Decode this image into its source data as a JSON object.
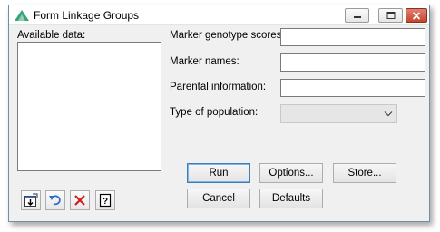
{
  "window": {
    "title": "Form Linkage Groups"
  },
  "titlebar_buttons": {
    "minimize_icon": "minimize-icon",
    "maximize_icon": "maximize-icon",
    "close_icon": "close-icon"
  },
  "available_data": {
    "label": "Available data:",
    "items": []
  },
  "fields": {
    "marker_genotype_scores": {
      "label": "Marker genotype scores:",
      "value": ""
    },
    "marker_names": {
      "label": "Marker names:",
      "value": ""
    },
    "parental_information": {
      "label": "Parental information:",
      "value": ""
    },
    "type_of_population": {
      "label": "Type of population:",
      "selected": ""
    }
  },
  "buttons": {
    "run": "Run",
    "options": "Options...",
    "store": "Store...",
    "cancel": "Cancel",
    "defaults": "Defaults"
  },
  "toolbar_icons": [
    "transfer-icon",
    "undo-icon",
    "clear-icon",
    "help-icon"
  ],
  "colors": {
    "accent_blue": "#3c7fb1",
    "close_red": "#c4472f",
    "clear_red": "#cc1f1f",
    "undo_blue": "#2a6fc9"
  }
}
